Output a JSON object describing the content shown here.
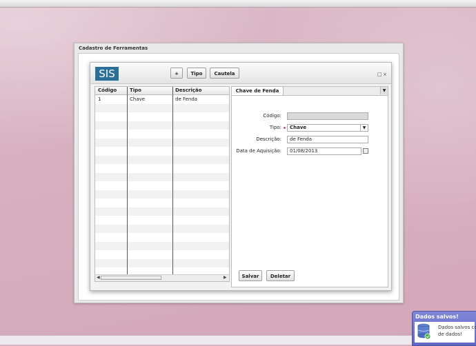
{
  "window": {
    "title": "Cadastro de Ferramentas"
  },
  "toolbar": {
    "logo": "SIS",
    "add_label": "+",
    "tipo_label": "Tipo",
    "cautela_label": "Cautela",
    "restore_icon": "□",
    "close_icon": "×"
  },
  "grid": {
    "columns": [
      "Código",
      "Tipo",
      "Descrição"
    ],
    "rows": [
      {
        "codigo": "1",
        "tipo": "Chave",
        "descricao": "de Fenda"
      }
    ]
  },
  "detail": {
    "tab_label": "Chave de Fenda",
    "fields": {
      "codigo_label": "Código:",
      "codigo_value": "",
      "tipo_label": "Tipo:",
      "tipo_value": "Chave",
      "descricao_label": "Descrição:",
      "descricao_value": "de Fenda",
      "data_label": "Data de Aquisição:",
      "data_value": "01/08/2013"
    },
    "save_label": "Salvar",
    "delete_label": "Deletar"
  },
  "notification": {
    "title": "Dados salvos!",
    "message_line1": "Dados salvos com",
    "message_line2": "de dados!"
  },
  "colors": {
    "logo_bg": "#2a6f98",
    "desktop_bg": "#d8b4c2",
    "notification_bg": "#6f77d0",
    "required_marker": "#d24d6d"
  }
}
